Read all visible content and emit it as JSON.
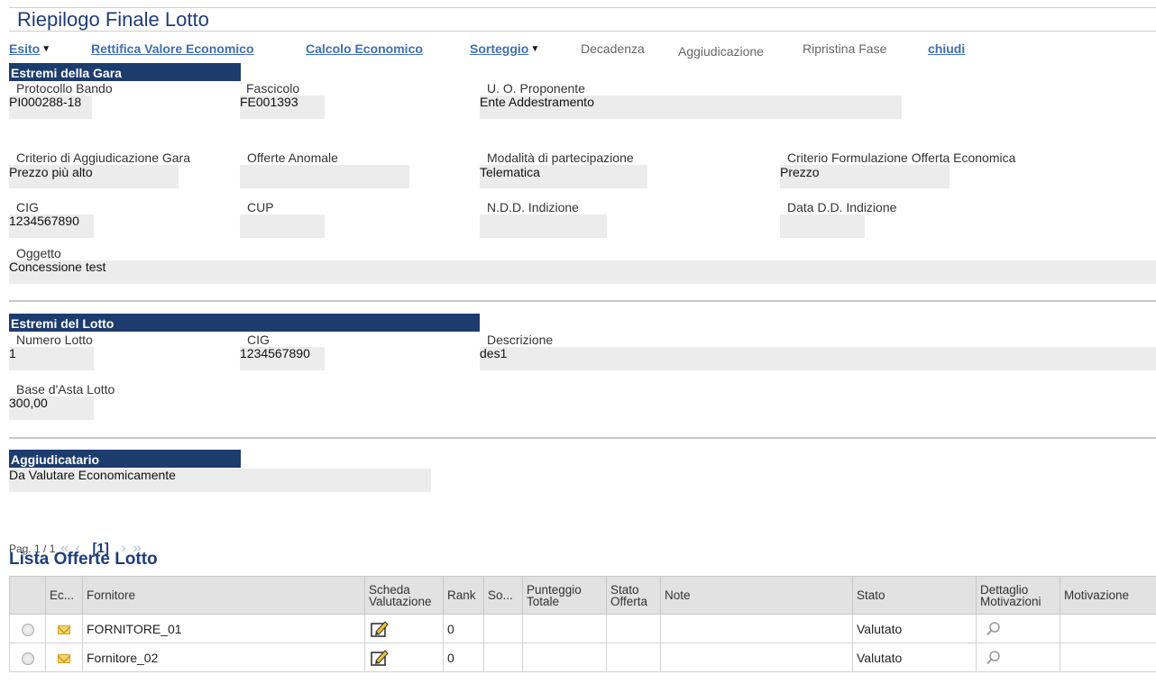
{
  "page": {
    "title": "Riepilogo Finale Lotto"
  },
  "toolbar": {
    "esito": "Esito",
    "rettifica": "Rettifica Valore Economico",
    "calcolo": "Calcolo Economico",
    "sorteggio": "Sorteggio",
    "decadenza": "Decadenza",
    "aggiudicazione": "Aggiudicazione",
    "ripristina": "Ripristina Fase",
    "chiudi": "chiudi"
  },
  "gara": {
    "header": "Estremi della Gara",
    "protocollo_label": "Protocollo Bando",
    "protocollo_value": "PI000288-18",
    "fascicolo_label": "Fascicolo",
    "fascicolo_value": "FE001393",
    "uo_label": "U. O. Proponente",
    "uo_value": "Ente Addestramento",
    "criterio_label": "Criterio di Aggiudicazione Gara",
    "criterio_value": "Prezzo più alto",
    "anomale_label": "Offerte Anomale",
    "anomale_value": "",
    "modalita_label": "Modalità di partecipazione",
    "modalita_value": "Telematica",
    "formulazione_label": "Criterio Formulazione Offerta Economica",
    "formulazione_value": "Prezzo",
    "cig_label": "CIG",
    "cig_value": "1234567890",
    "cup_label": "CUP",
    "cup_value": "",
    "ndd_label": "N.D.D. Indizione",
    "ndd_value": "",
    "datadd_label": "Data D.D. Indizione",
    "datadd_value": "",
    "oggetto_label": "Oggetto",
    "oggetto_value": "Concessione test"
  },
  "lotto": {
    "header": "Estremi del Lotto",
    "numero_label": "Numero Lotto",
    "numero_value": "1",
    "cig_label": "CIG",
    "cig_value": "1234567890",
    "descrizione_label": "Descrizione",
    "descrizione_value": "des1",
    "base_label": "Base d'Asta Lotto",
    "base_value": "300,00"
  },
  "aggiudicatario": {
    "header": "Aggiudicatario",
    "value": "Da Valutare Economicamente"
  },
  "pagination": {
    "text": "Pag. 1 / 1",
    "first": "«",
    "prev": "‹",
    "current": "[1]",
    "next": "›",
    "last": "»"
  },
  "list": {
    "title": "Lista Offerte Lotto",
    "columns": {
      "ec": "Ec...",
      "fornitore": "Fornitore",
      "scheda_1": "Scheda",
      "scheda_2": "Valutazione",
      "rank": "Rank",
      "so": "So...",
      "punteggio_1": "Punteggio",
      "punteggio_2": "Totale",
      "stato_offerta_1": "Stato",
      "stato_offerta_2": "Offerta",
      "note": "Note",
      "stato": "Stato",
      "dettaglio_1": "Dettaglio",
      "dettaglio_2": "Motivazioni",
      "motivazione": "Motivazione"
    },
    "rows": [
      {
        "fornitore": "FORNITORE_01",
        "rank": "0",
        "stato": "Valutato"
      },
      {
        "fornitore": "Fornitore_02",
        "rank": "0",
        "stato": "Valutato"
      }
    ]
  },
  "icons": {
    "caret": "caret-down-icon",
    "scheda": "edit-sheet-icon",
    "dettaglio": "magnifier-icon",
    "envelope": "envelope-icon"
  }
}
